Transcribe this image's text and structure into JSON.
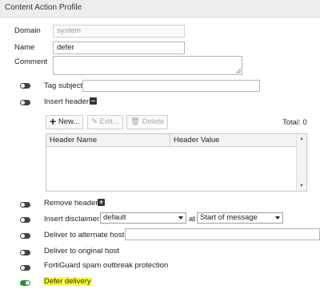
{
  "title": "Content Action Profile",
  "fields": {
    "domain_label": "Domain",
    "domain_value": "system",
    "name_label": "Name",
    "name_value": "defer",
    "comment_label": "Comment",
    "comment_value": ""
  },
  "tag_subject": {
    "label": "Tag subject",
    "value": "",
    "enabled": false
  },
  "insert_header": {
    "label": "Insert header",
    "enabled": false,
    "toolbar": {
      "new_label": "New...",
      "edit_label": "Edit...",
      "delete_label": "Delete",
      "total_label": "Total: 0"
    },
    "columns": [
      "Header Name",
      "Header Value"
    ]
  },
  "remove_header": {
    "label": "Remove header",
    "enabled": false
  },
  "insert_disclaimer": {
    "label": "Insert disclaimer",
    "enabled": false,
    "disclaimer_value": "default",
    "at_label": "at",
    "position_value": "Start of message"
  },
  "deliver_alternate": {
    "label": "Deliver to alternate host",
    "enabled": false,
    "value": ""
  },
  "deliver_original": {
    "label": "Deliver to original host",
    "enabled": false
  },
  "fortiguard": {
    "label": "FortiGuard spam outbreak protection",
    "enabled": false
  },
  "defer_delivery": {
    "label": "Defer delivery",
    "enabled": true,
    "highlight_color": "#ffff33"
  },
  "colors": {
    "toggle_on": "#2e8b3c",
    "toggle_off": "#444444",
    "titlebar": "#ededed"
  }
}
